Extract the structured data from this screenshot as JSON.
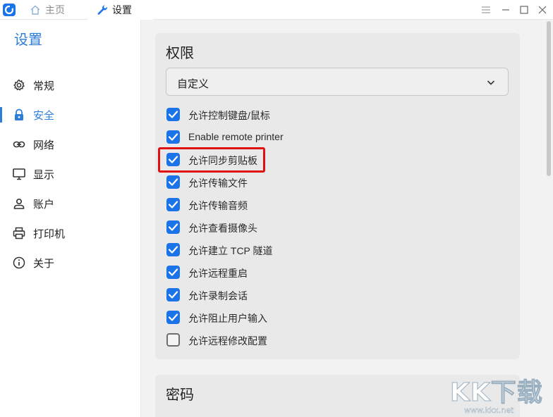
{
  "tabs": [
    {
      "label": "主页",
      "icon": "home-icon"
    },
    {
      "label": "设置",
      "icon": "wrench-icon"
    }
  ],
  "sidebar": {
    "title": "设置",
    "items": [
      {
        "label": "常规",
        "icon": "gear-icon"
      },
      {
        "label": "安全",
        "icon": "lock-icon",
        "active": true
      },
      {
        "label": "网络",
        "icon": "link-icon"
      },
      {
        "label": "显示",
        "icon": "monitor-icon"
      },
      {
        "label": "账户",
        "icon": "user-icon"
      },
      {
        "label": "打印机",
        "icon": "printer-icon"
      },
      {
        "label": "关于",
        "icon": "info-icon"
      }
    ]
  },
  "permissions": {
    "title": "权限",
    "preset": "自定义",
    "options": [
      {
        "label": "允许控制键盘/鼠标",
        "checked": true
      },
      {
        "label": "Enable remote printer",
        "checked": true
      },
      {
        "label": "允许同步剪贴板",
        "checked": true
      },
      {
        "label": "允许传输文件",
        "checked": true
      },
      {
        "label": "允许传输音频",
        "checked": true
      },
      {
        "label": "允许查看摄像头",
        "checked": true
      },
      {
        "label": "允许建立 TCP 隧道",
        "checked": true
      },
      {
        "label": "允许远程重启",
        "checked": true
      },
      {
        "label": "允许录制会话",
        "checked": true
      },
      {
        "label": "允许阻止用户输入",
        "checked": true
      },
      {
        "label": "允许远程修改配置",
        "checked": false
      }
    ]
  },
  "password": {
    "title": "密码"
  },
  "watermark": {
    "brand": "KK下载",
    "url": "www.kkx.net"
  },
  "colors": {
    "accent": "#2e7dd8",
    "checkbox": "#1a73e8",
    "highlight": "#e01010"
  }
}
